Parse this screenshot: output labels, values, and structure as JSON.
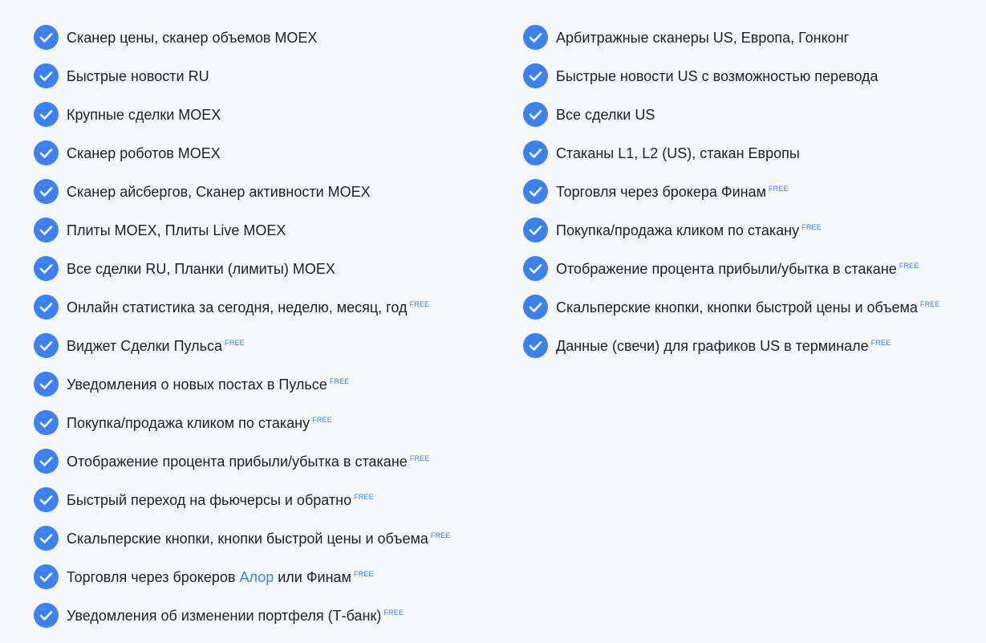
{
  "accent_color": "#3b82f0",
  "free_badge": "FREE",
  "left_column": [
    {
      "text": "Сканер цены, сканер объемов MOEX",
      "free": false
    },
    {
      "text": "Быстрые новости RU",
      "free": false
    },
    {
      "text": "Крупные сделки MOEX",
      "free": false
    },
    {
      "text": "Сканер роботов MOEX",
      "free": false
    },
    {
      "text": "Сканер айсбергов, Сканер активности MOEX",
      "free": false
    },
    {
      "text": "Плиты MOEX, Плиты Live MOEX",
      "free": false
    },
    {
      "text": "Все сделки RU, Планки (лимиты) MOEX",
      "free": false
    },
    {
      "text": "Онлайн статистика за сегодня, неделю, месяц, год",
      "free": true
    },
    {
      "text": "Виджет Сделки Пульса",
      "free": true
    },
    {
      "text": "Уведомления о новых постах в Пульсе",
      "free": true
    },
    {
      "text": "Покупка/продажа кликом по стакану",
      "free": true
    },
    {
      "text": "Отображение процента прибыли/убытка в стакане",
      "free": true
    },
    {
      "text": "Быстрый переход на фьючерсы и обратно",
      "free": true
    },
    {
      "text": "Скальперские кнопки, кнопки быстрой цены и объема",
      "free": true
    },
    {
      "text_before": "Торговля через брокеров",
      "link": "Алор",
      "text_after": "или Финам",
      "free": true
    },
    {
      "text": "Уведомления об изменении портфеля (Т-банк)",
      "free": true
    }
  ],
  "right_column": [
    {
      "text": "Арбитражные сканеры US, Европа, Гонконг",
      "free": false
    },
    {
      "text": "Быстрые новости US с возможностью перевода",
      "free": false
    },
    {
      "text": "Все сделки US",
      "free": false
    },
    {
      "text": "Стаканы L1, L2 (US), стакан Европы",
      "free": false
    },
    {
      "text": "Торговля через брокера Финам",
      "free": true
    },
    {
      "text": "Покупка/продажа кликом по стакану",
      "free": true
    },
    {
      "text": "Отображение процента прибыли/убытка в стакане",
      "free": true
    },
    {
      "text": "Скальперские кнопки, кнопки быстрой цены и объема",
      "free": true
    },
    {
      "text": "Данные (свечи) для графиков US в терминале",
      "free": true
    }
  ]
}
